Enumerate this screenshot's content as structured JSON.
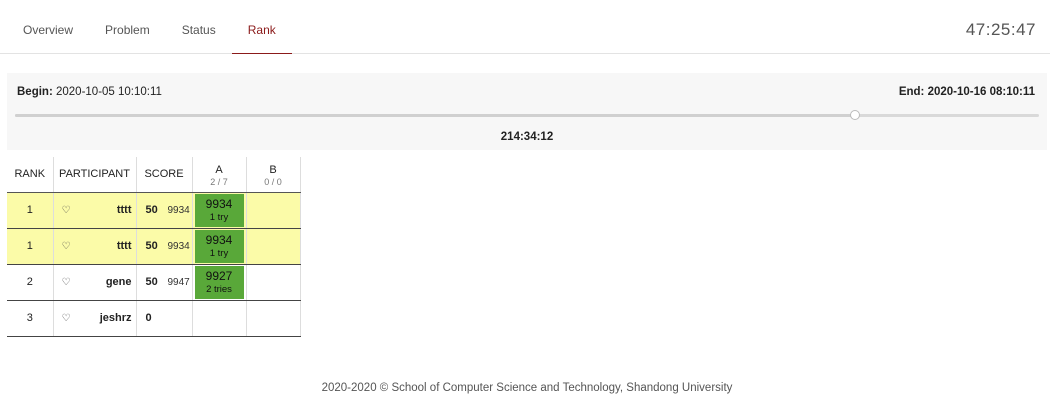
{
  "nav": {
    "tabs": [
      {
        "label": "Overview"
      },
      {
        "label": "Problem"
      },
      {
        "label": "Status"
      },
      {
        "label": "Rank"
      }
    ],
    "active_tab": "Rank",
    "countdown": "47:25:47"
  },
  "progress": {
    "begin_label": "Begin:",
    "begin_value": "2020-10-05 10:10:11",
    "end_label": "End:",
    "end_value": "2020-10-16 08:10:11",
    "elapsed": "214:34:12",
    "fraction": 0.8199
  },
  "table": {
    "headers": {
      "rank": "RANK",
      "participant": "PARTICIPANT",
      "score": "SCORE"
    },
    "problems": [
      {
        "name": "A",
        "stat": "2 / 7"
      },
      {
        "name": "B",
        "stat": "0 / 0"
      }
    ],
    "rows": [
      {
        "rank": "1",
        "name": "tttt",
        "score": "50",
        "penalty": "9934",
        "highlight": true,
        "separator": true,
        "cells": [
          {
            "time": "9934",
            "tries": "1 try"
          },
          null
        ]
      },
      {
        "rank": "1",
        "name": "tttt",
        "score": "50",
        "penalty": "9934",
        "highlight": true,
        "separator": false,
        "cells": [
          {
            "time": "9934",
            "tries": "1 try"
          },
          null
        ]
      },
      {
        "rank": "2",
        "name": "gene",
        "score": "50",
        "penalty": "9947",
        "highlight": false,
        "separator": false,
        "cells": [
          {
            "time": "9927",
            "tries": "2 tries"
          },
          null
        ]
      },
      {
        "rank": "3",
        "name": "jeshrz",
        "score": "0",
        "penalty": "",
        "highlight": false,
        "separator": false,
        "cells": [
          null,
          null
        ]
      }
    ]
  },
  "icons": {
    "favorite": "heart-icon",
    "heart_glyph": "♡"
  },
  "colors": {
    "accent": "#8b1a1a",
    "highlight_row": "#fbfba8",
    "accepted": "#59a839"
  },
  "footer": "2020-2020 © School of Computer Science and Technology, Shandong University"
}
